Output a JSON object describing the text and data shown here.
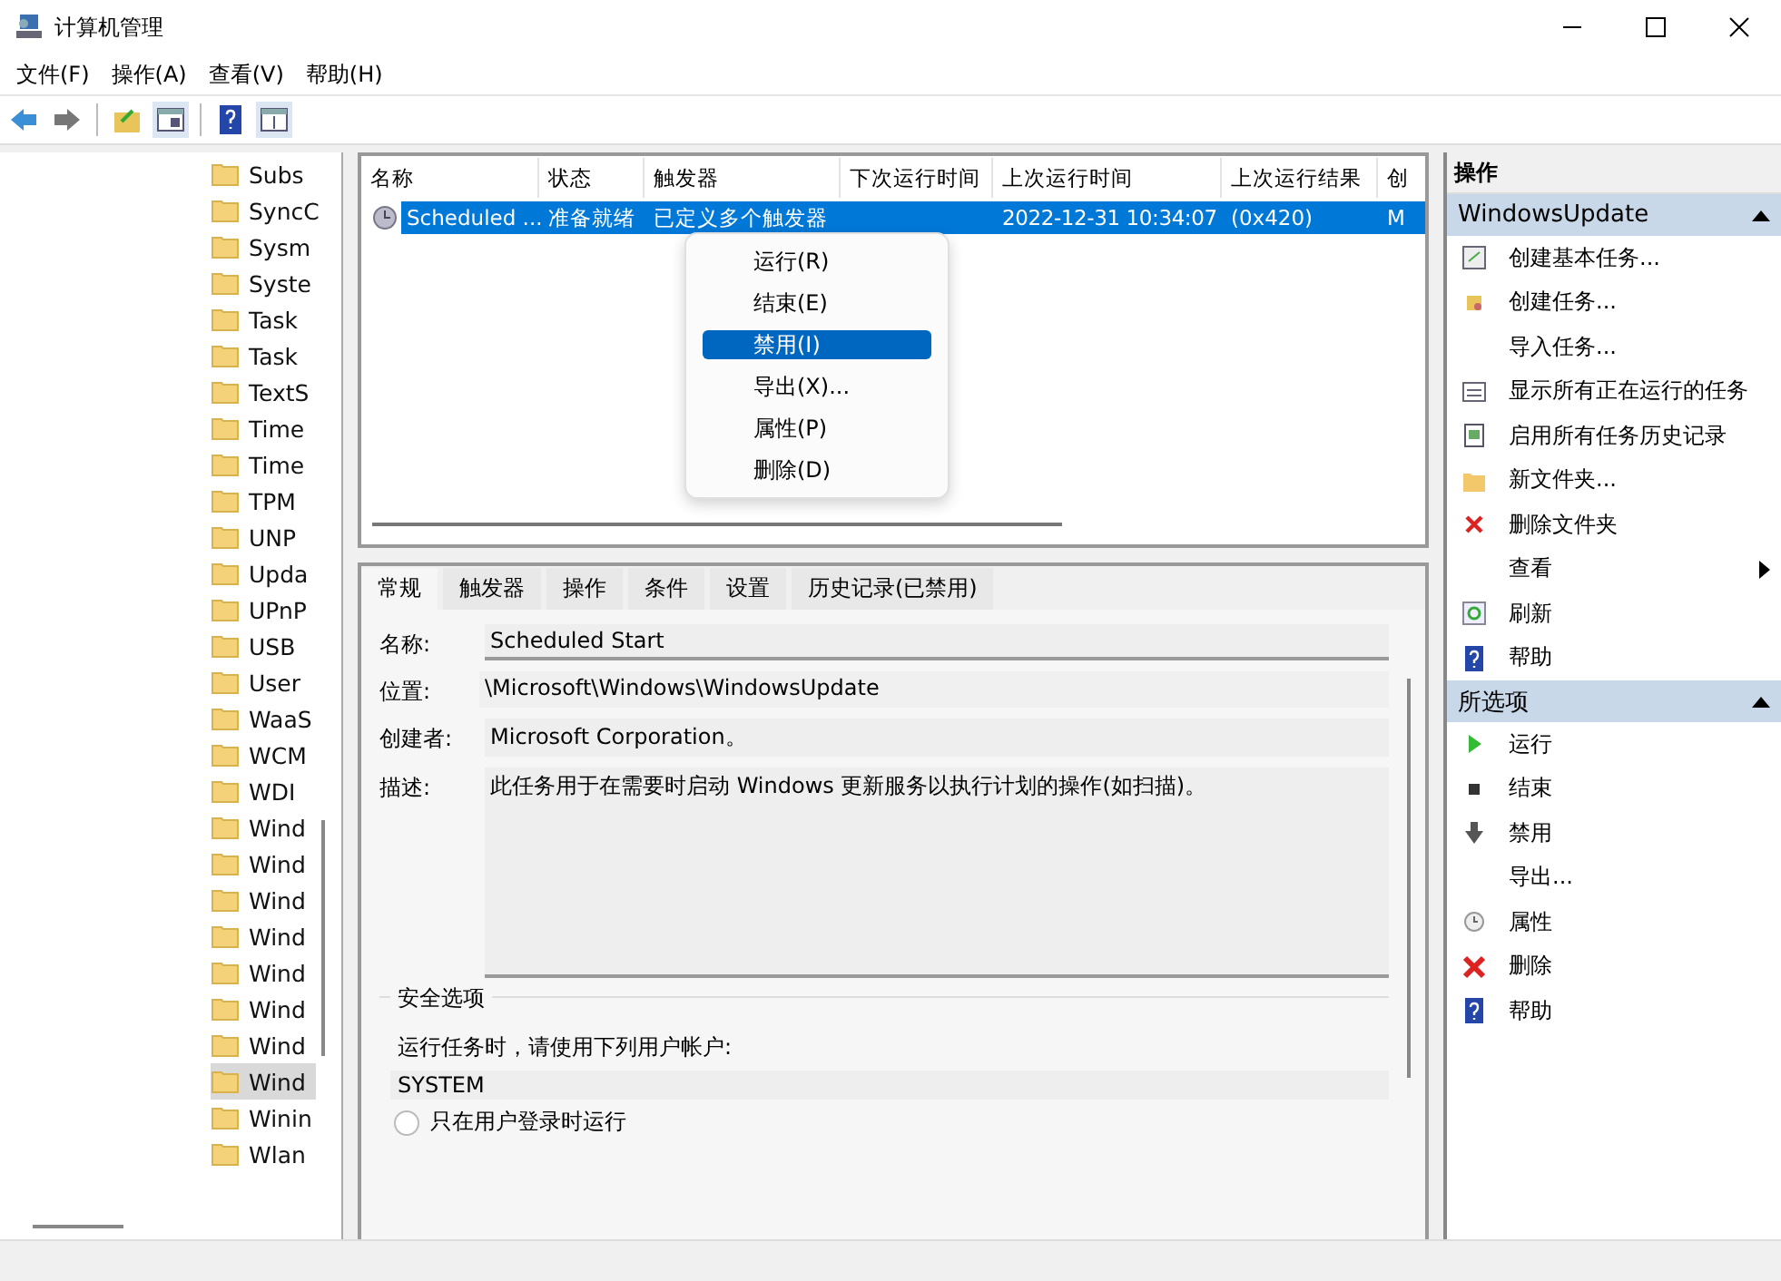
{
  "window": {
    "title": "计算机管理"
  },
  "menu_bar": [
    "文件(F)",
    "操作(A)",
    "查看(V)",
    "帮助(H)"
  ],
  "tree": {
    "items": [
      {
        "label": "Subs",
        "selected": false
      },
      {
        "label": "SyncC",
        "selected": false
      },
      {
        "label": "Sysm",
        "selected": false
      },
      {
        "label": "Syste",
        "selected": false
      },
      {
        "label": "Task",
        "selected": false
      },
      {
        "label": "Task",
        "selected": false
      },
      {
        "label": "TextS",
        "selected": false
      },
      {
        "label": "Time",
        "selected": false
      },
      {
        "label": "Time",
        "selected": false
      },
      {
        "label": "TPM",
        "selected": false
      },
      {
        "label": "UNP",
        "selected": false
      },
      {
        "label": "Upda",
        "selected": false
      },
      {
        "label": "UPnP",
        "selected": false
      },
      {
        "label": "USB",
        "selected": false
      },
      {
        "label": "User",
        "selected": false
      },
      {
        "label": "WaaS",
        "selected": false
      },
      {
        "label": "WCM",
        "selected": false
      },
      {
        "label": "WDI",
        "selected": false
      },
      {
        "label": "Wind",
        "selected": false
      },
      {
        "label": "Wind",
        "selected": false
      },
      {
        "label": "Wind",
        "selected": false
      },
      {
        "label": "Wind",
        "selected": false
      },
      {
        "label": "Wind",
        "selected": false
      },
      {
        "label": "Wind",
        "selected": false
      },
      {
        "label": "Wind",
        "selected": false
      },
      {
        "label": "Wind",
        "selected": true
      },
      {
        "label": "Winin",
        "selected": false
      },
      {
        "label": "Wlan",
        "selected": false
      }
    ]
  },
  "table": {
    "columns": [
      "名称",
      "状态",
      "触发器",
      "下次运行时间",
      "上次运行时间",
      "上次运行结果",
      "创"
    ],
    "rows": [
      {
        "selected": true,
        "cells": [
          "Scheduled ...",
          "准备就绪",
          "已定义多个触发器",
          "",
          "2022-12-31 10:34:07",
          "(0x420)",
          "M"
        ]
      }
    ]
  },
  "context_menu": [
    {
      "label": "运行(R)",
      "selected": false
    },
    {
      "label": "结束(E)",
      "selected": false
    },
    {
      "label": "禁用(I)",
      "selected": true
    },
    {
      "label": "导出(X)...",
      "selected": false
    },
    {
      "label": "属性(P)",
      "selected": false
    },
    {
      "label": "删除(D)",
      "selected": false
    }
  ],
  "detail_tabs": [
    {
      "label": "常规",
      "selected": true
    },
    {
      "label": "触发器",
      "selected": false
    },
    {
      "label": "操作",
      "selected": false
    },
    {
      "label": "条件",
      "selected": false
    },
    {
      "label": "设置",
      "selected": false
    },
    {
      "label": "历史记录(已禁用)",
      "selected": false
    }
  ],
  "general": {
    "name_label": "名称:",
    "name": "Scheduled Start",
    "location_label": "位置:",
    "location": "\\Microsoft\\Windows\\WindowsUpdate",
    "author_label": "创建者:",
    "author": "Microsoft Corporation。",
    "description_label": "描述:",
    "description": "此任务用于在需要时启动 Windows 更新服务以执行计划的操作(如扫描)。",
    "security": {
      "title": "安全选项",
      "prompt": "运行任务时，请使用下列用户帐户:",
      "account": "SYSTEM",
      "options": [
        {
          "label": "只在用户登录时运行",
          "selected": false
        }
      ]
    }
  },
  "actions": {
    "title": "操作",
    "sections": [
      {
        "title": "WindowsUpdate",
        "expanded": true,
        "items": [
          {
            "label": "创建基本任务...",
            "kind": "wizard"
          },
          {
            "label": "创建任务...",
            "kind": "task"
          },
          {
            "label": "导入任务...",
            "kind": "plain"
          },
          {
            "label": "显示所有正在运行的任务",
            "kind": "list"
          },
          {
            "label": "启用所有任务历史记录",
            "kind": "log"
          },
          {
            "label": "新文件夹...",
            "kind": "folder"
          },
          {
            "label": "删除文件夹",
            "kind": "delete"
          },
          {
            "label": "查看",
            "kind": "submenu"
          },
          {
            "label": "刷新",
            "kind": "refresh"
          },
          {
            "label": "帮助",
            "kind": "help"
          }
        ]
      },
      {
        "title": "所选项",
        "expanded": true,
        "items": [
          {
            "label": "运行",
            "kind": "run"
          },
          {
            "label": "结束",
            "kind": "stop"
          },
          {
            "label": "禁用",
            "kind": "disable"
          },
          {
            "label": "导出...",
            "kind": "plain"
          },
          {
            "label": "属性",
            "kind": "properties"
          },
          {
            "label": "删除",
            "kind": "remove"
          },
          {
            "label": "帮助",
            "kind": "help"
          }
        ]
      }
    ]
  }
}
